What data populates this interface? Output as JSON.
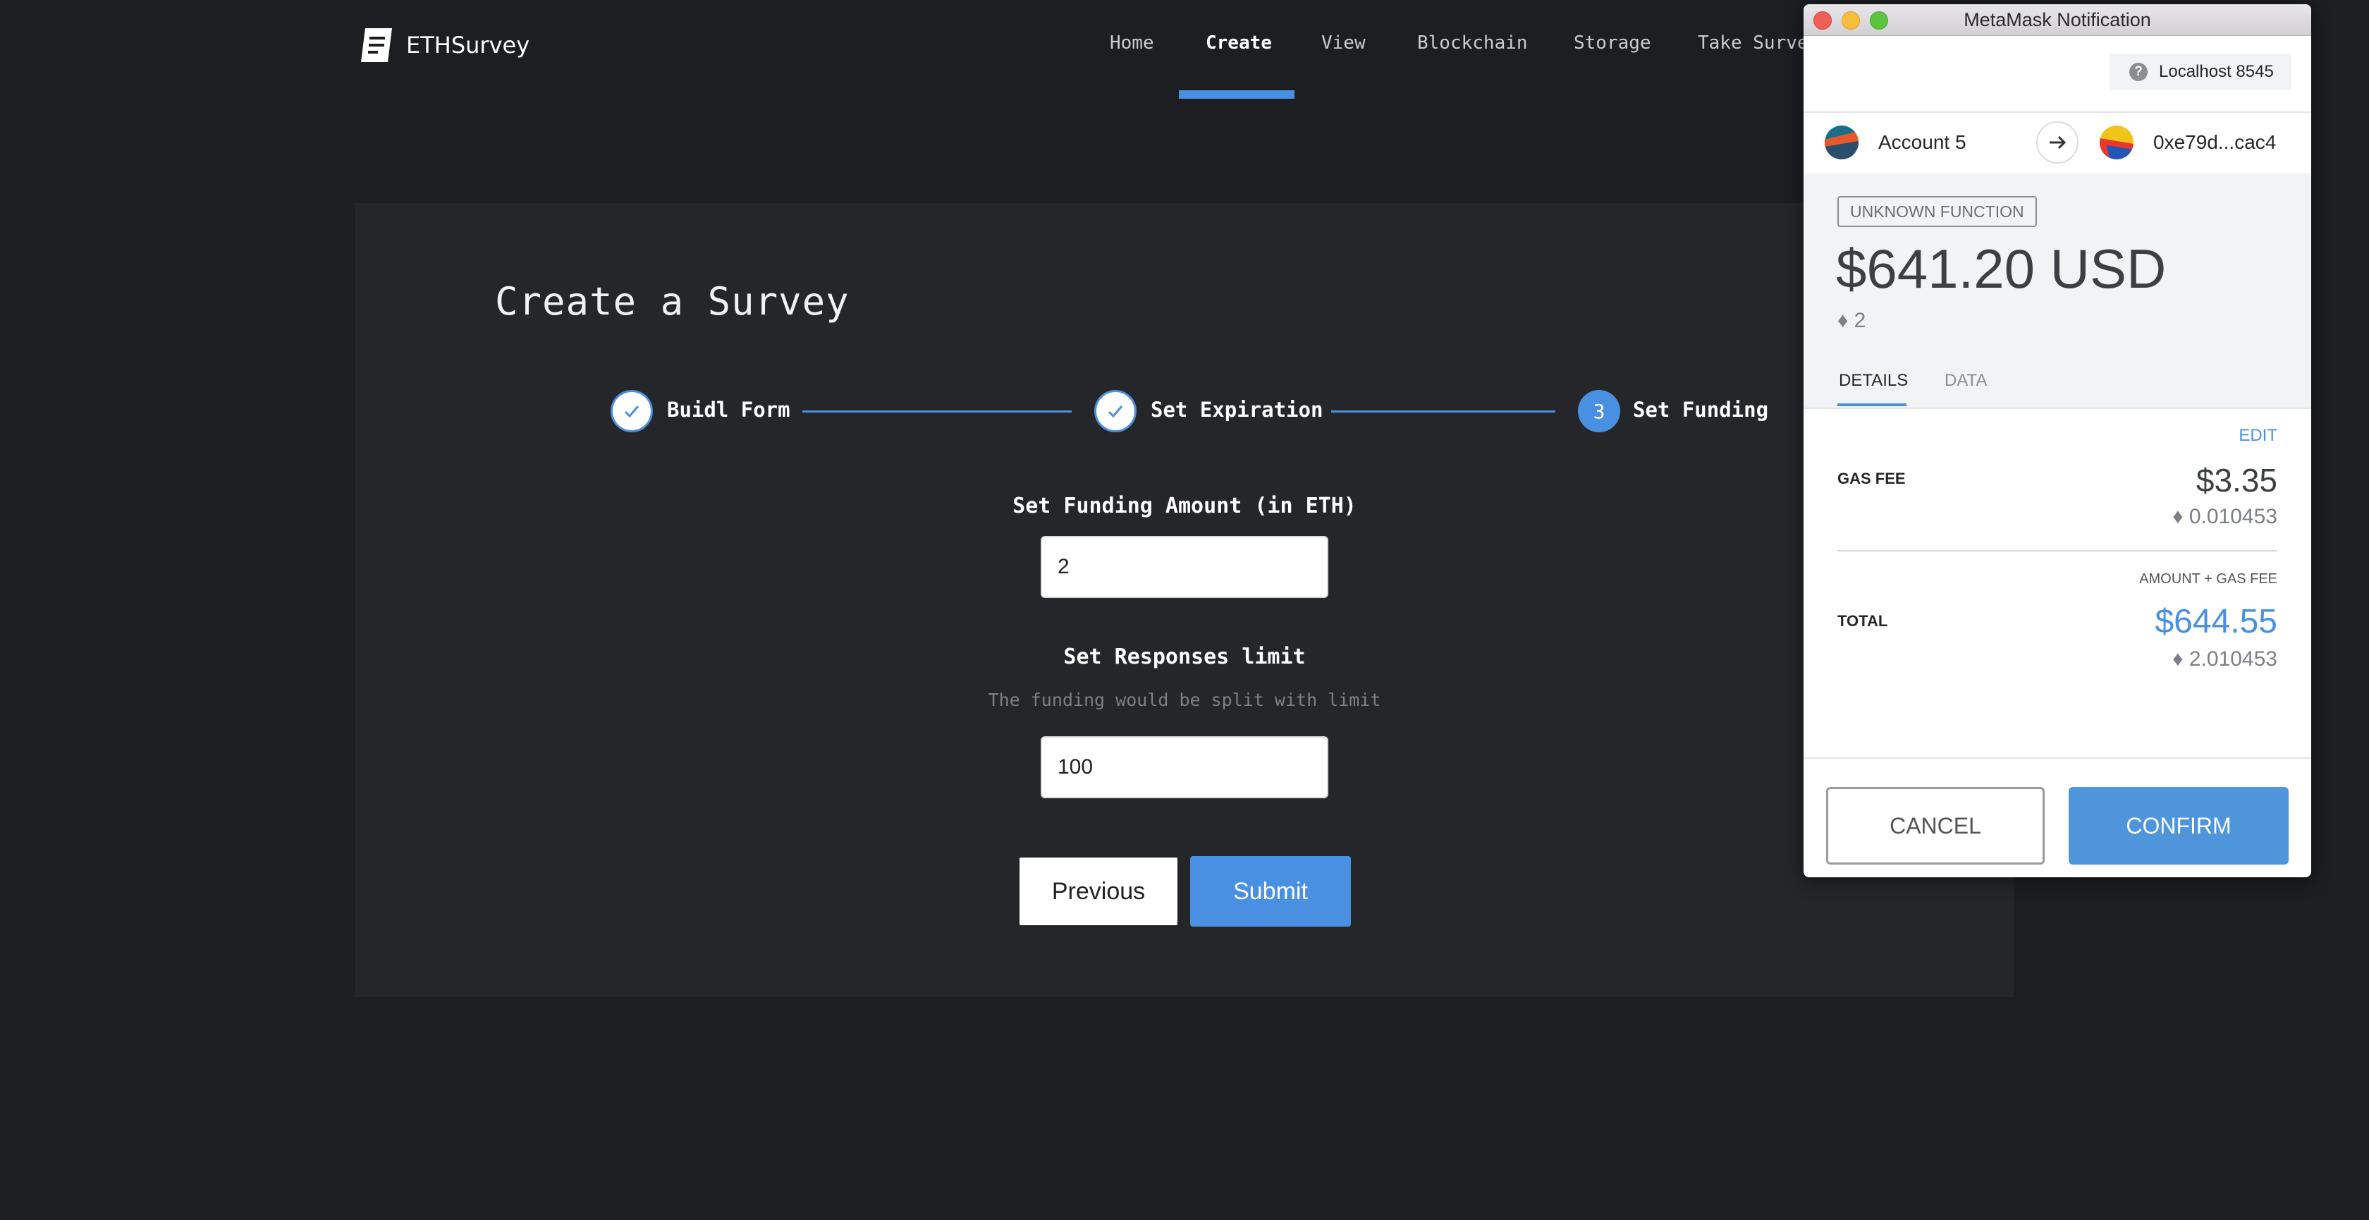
{
  "app": {
    "logo_name": "ETHSurvey",
    "logo_icon": "document-icon"
  },
  "nav": {
    "items": [
      {
        "label": "Home",
        "active": false
      },
      {
        "label": "Create",
        "active": true
      },
      {
        "label": "View",
        "active": false
      },
      {
        "label": "Blockchain",
        "active": false
      },
      {
        "label": "Storage",
        "active": false
      },
      {
        "label": "Take Survey",
        "active": false
      }
    ]
  },
  "form": {
    "title": "Create a Survey",
    "steps": [
      {
        "label": "Buidl Form",
        "status": "done",
        "icon": "checkmark-icon"
      },
      {
        "label": "Set Expiration",
        "status": "done",
        "icon": "checkmark-icon"
      },
      {
        "label": "Set Funding",
        "status": "current",
        "number": "3"
      }
    ],
    "funding_label": "Set Funding Amount (in ETH)",
    "funding_value": "2",
    "limit_label": "Set Responses limit",
    "limit_hint": "The funding would be split with limit",
    "limit_value": "100",
    "previous_label": "Previous",
    "submit_label": "Submit"
  },
  "metamask": {
    "window_title": "MetaMask Notification",
    "network": "Localhost 8545",
    "from_account": "Account 5",
    "to_address": "0xe79d...cac4",
    "function_badge": "UNKNOWN FUNCTION",
    "amount_fiat": "$641.20 USD",
    "amount_eth": "♦ 2",
    "tabs": [
      "DETAILS",
      "DATA"
    ],
    "active_tab": "DETAILS",
    "edit_label": "EDIT",
    "gas_fee_label": "GAS FEE",
    "gas_fee_fiat": "$3.35",
    "gas_fee_eth": "♦ 0.010453",
    "total_sublabel": "AMOUNT + GAS FEE",
    "total_label": "TOTAL",
    "total_fiat": "$644.55",
    "total_eth": "♦ 2.010453",
    "cancel_label": "CANCEL",
    "confirm_label": "CONFIRM"
  },
  "colors": {
    "background": "#1d1e22",
    "card": "#25262a",
    "accent": "#4a90e2",
    "total_highlight": "#4a90e2"
  }
}
